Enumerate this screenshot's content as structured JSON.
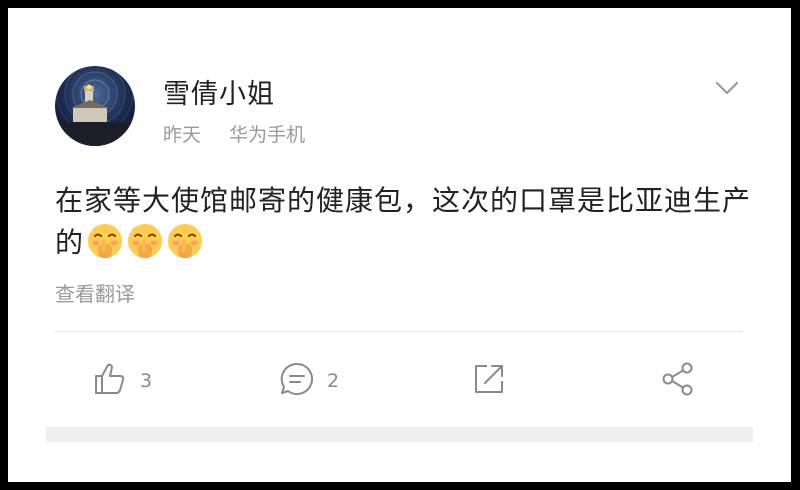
{
  "post": {
    "username": "雪倩小姐",
    "time": "昨天",
    "device": "华为手机",
    "content_text": "在家等大使馆邮寄的健康包，这次的口罩是比亚迪生产的",
    "emojis": [
      "shushing-face-emoji",
      "shushing-face-emoji",
      "shushing-face-emoji"
    ],
    "translate_label": "查看翻译"
  },
  "actions": {
    "like_count": "3",
    "comment_count": "2"
  },
  "icons": {
    "menu": "chevron-down-icon",
    "like": "thumbs-up-icon",
    "comment": "comment-icon",
    "share": "share-external-icon",
    "forward": "share-nodes-icon"
  },
  "colors": {
    "text_primary": "#222222",
    "text_secondary": "#9a9a9a",
    "icon_gray": "#8a8a8a",
    "background": "#ffffff"
  }
}
